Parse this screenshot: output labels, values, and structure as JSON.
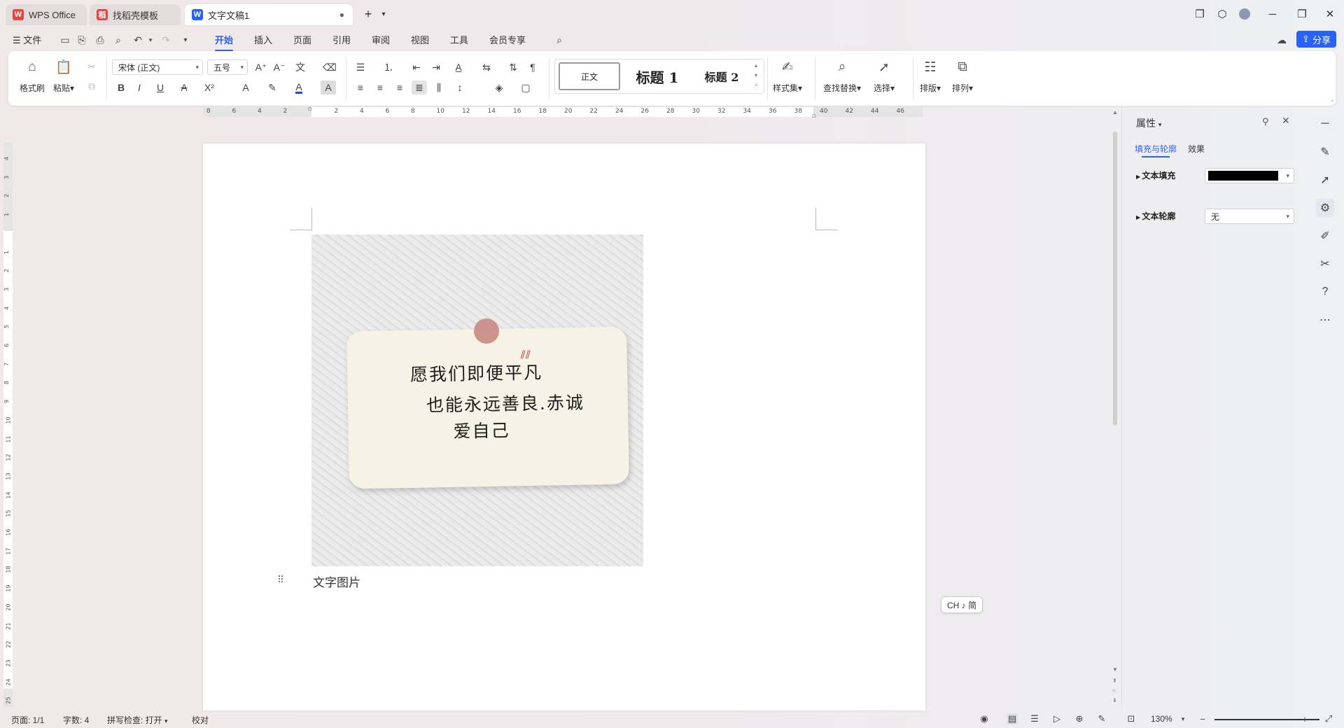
{
  "tabs": [
    {
      "label": "WPS Office",
      "logo": "W",
      "logo_color": "#e8453c"
    },
    {
      "label": "找稻壳模板",
      "logo": "稻",
      "logo_color": "#e04646"
    },
    {
      "label": "文字文稿1",
      "logo": "W",
      "logo_color": "#2a62f4"
    }
  ],
  "new_tab_label": "+",
  "menu": {
    "file_label": "文件",
    "items": [
      "开始",
      "插入",
      "页面",
      "引用",
      "审阅",
      "视图",
      "工具",
      "会员专享"
    ],
    "active": "开始",
    "share_label": "分享"
  },
  "ribbon": {
    "format_painter": "格式刷",
    "paste": "粘贴",
    "font_name": "宋体 (正文)",
    "font_size": "五号",
    "styles": [
      "正文",
      "标题 1",
      "标题 2"
    ],
    "style_set": "样式集",
    "find_replace": "查找替换",
    "select": "选择",
    "layout": "排版",
    "arrange": "排列"
  },
  "ruler": {
    "h_ticks": [
      "8",
      "6",
      "4",
      "2",
      "",
      "2",
      "4",
      "6",
      "8",
      "10",
      "12",
      "14",
      "16",
      "18",
      "20",
      "22",
      "24",
      "26",
      "28",
      "30",
      "32",
      "34",
      "36",
      "38",
      "40",
      "42",
      "44",
      "46"
    ],
    "v_ticks": [
      "4",
      "3",
      "2",
      "1",
      "",
      "1",
      "2",
      "3",
      "4",
      "5",
      "6",
      "7",
      "8",
      "9",
      "10",
      "11",
      "12",
      "13",
      "14",
      "15",
      "16",
      "17",
      "18",
      "19",
      "20",
      "21",
      "22",
      "23",
      "24",
      "25"
    ]
  },
  "document": {
    "note_lines": [
      "愿我们即便平凡",
      "也能永远善良.赤诚",
      "爱自己"
    ],
    "caption": "文字图片"
  },
  "ime_indicator": "CH ♪ 简",
  "properties": {
    "title": "属性",
    "tabs": [
      "填充与轮廓",
      "效果"
    ],
    "active_tab": "填充与轮廓",
    "text_fill_label": "文本填充",
    "text_fill_color": "#000000",
    "text_outline_label": "文本轮廓",
    "text_outline_value": "无"
  },
  "status": {
    "page": "页面: 1/1",
    "words": "字数: 4",
    "spellcheck": "拼写检查: 打开",
    "proofread": "校对",
    "zoom": "130%"
  },
  "colors": {
    "accent": "#2a62f4",
    "font_color_bar": "#1a4fd8"
  }
}
